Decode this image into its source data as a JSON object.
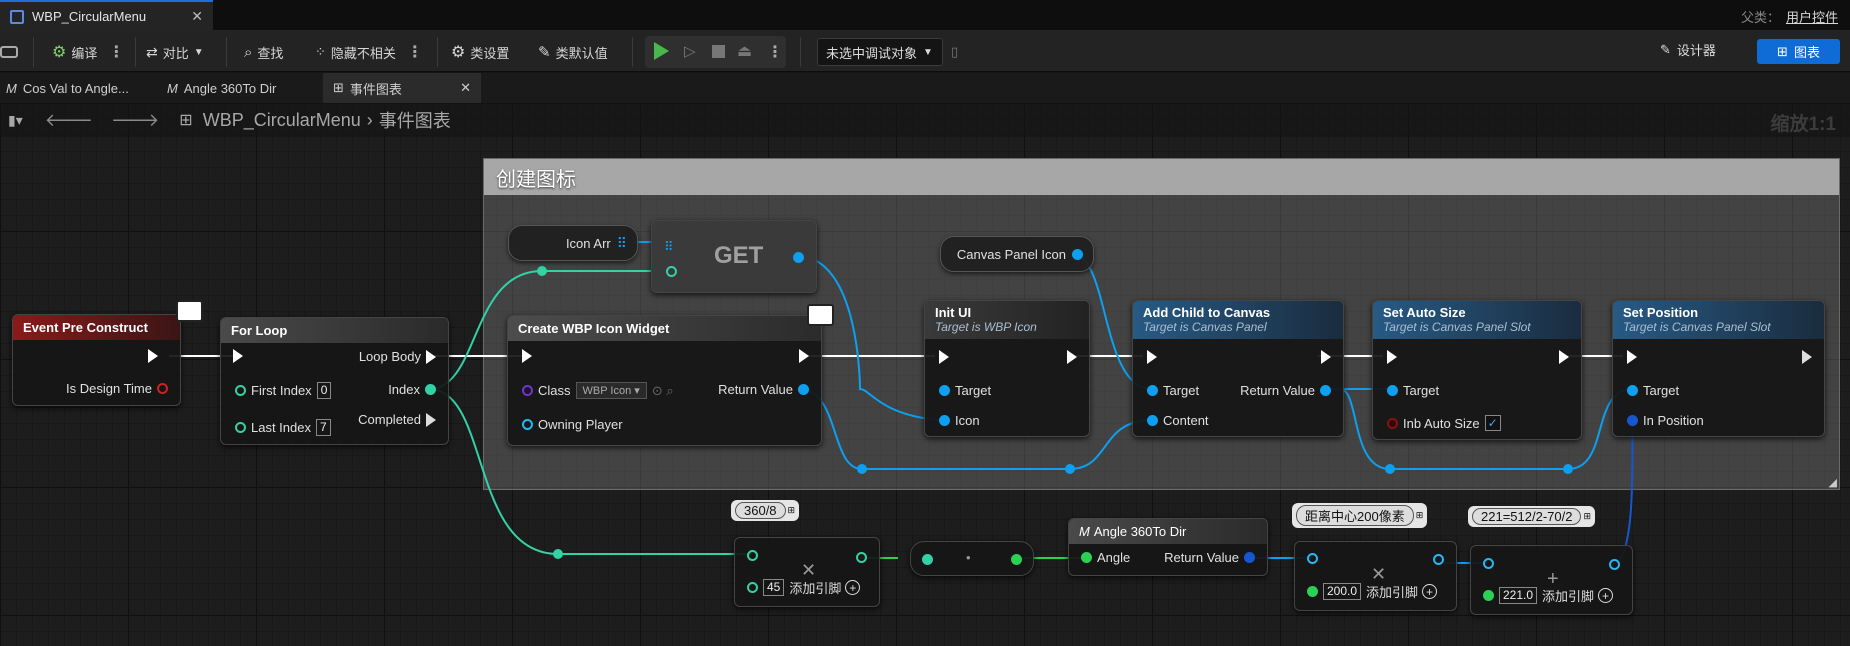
{
  "titlebar": {
    "tab_title": "WBP_CircularMenu",
    "parent_label": "父类：",
    "parent_value": "用户控件"
  },
  "toolbar": {
    "compile": "编译",
    "diff": "对比",
    "find": "查找",
    "hide_unrelated": "隐藏不相关",
    "class_settings": "类设置",
    "class_defaults": "类默认值",
    "debug_object": "未选中调试对象",
    "designer": "设计器",
    "graph": "图表"
  },
  "graph_tabs": [
    "Cos Val to Angle...",
    "Angle 360To Dir",
    "事件图表"
  ],
  "breadcrumb": {
    "root": "WBP_CircularMenu",
    "current": "事件图表",
    "zoom": "缩放1:1"
  },
  "comment": {
    "title": "创建图标"
  },
  "nodes": {
    "event_pre_construct": {
      "title": "Event Pre Construct",
      "is_design_time": "Is Design Time"
    },
    "for_loop": {
      "title": "For Loop",
      "first_index": "First Index",
      "first_index_value": "0",
      "last_index": "Last Index",
      "last_index_value": "7",
      "loop_body": "Loop Body",
      "index": "Index",
      "completed": "Completed"
    },
    "icon_arr": {
      "title": "Icon Arr"
    },
    "get": {
      "title": "GET"
    },
    "canvas_panel_icon": {
      "title": "Canvas Panel Icon"
    },
    "create_widget": {
      "title": "Create WBP Icon Widget",
      "class": "Class",
      "class_value": "WBP Icon",
      "owning_player": "Owning Player",
      "return_value": "Return Value"
    },
    "init_ui": {
      "title": "Init UI",
      "subtitle": "Target is WBP Icon",
      "target": "Target",
      "icon": "Icon"
    },
    "add_child": {
      "title": "Add Child to Canvas",
      "subtitle": "Target is Canvas Panel",
      "target": "Target",
      "content": "Content",
      "return_value": "Return Value"
    },
    "set_auto_size": {
      "title": "Set Auto Size",
      "subtitle": "Target is Canvas Panel Slot",
      "target": "Target",
      "inb_auto_size": "Inb Auto Size"
    },
    "set_position": {
      "title": "Set Position",
      "subtitle": "Target is Canvas Panel Slot",
      "target": "Target",
      "in_position": "In Position"
    },
    "multiply1": {
      "comment": "360/8",
      "value": "45",
      "add_pin": "添加引脚"
    },
    "angle360": {
      "title": "Angle 360To Dir",
      "angle": "Angle",
      "return_value": "Return Value"
    },
    "multiply2": {
      "comment": "距离中心200像素",
      "value": "200.0",
      "add_pin": "添加引脚"
    },
    "add": {
      "comment": "221=512/2-70/2",
      "value": "221.0",
      "add_pin": "添加引脚"
    }
  },
  "colors": {
    "accent": "#0f6bd6",
    "event_header": "#8b1a1a",
    "function_header": "#275a85",
    "exec_pin": "#ffffff",
    "object_pin": "#0d9ff0",
    "int_pin": "#33d1a4",
    "float_pin": "#2ad155"
  }
}
